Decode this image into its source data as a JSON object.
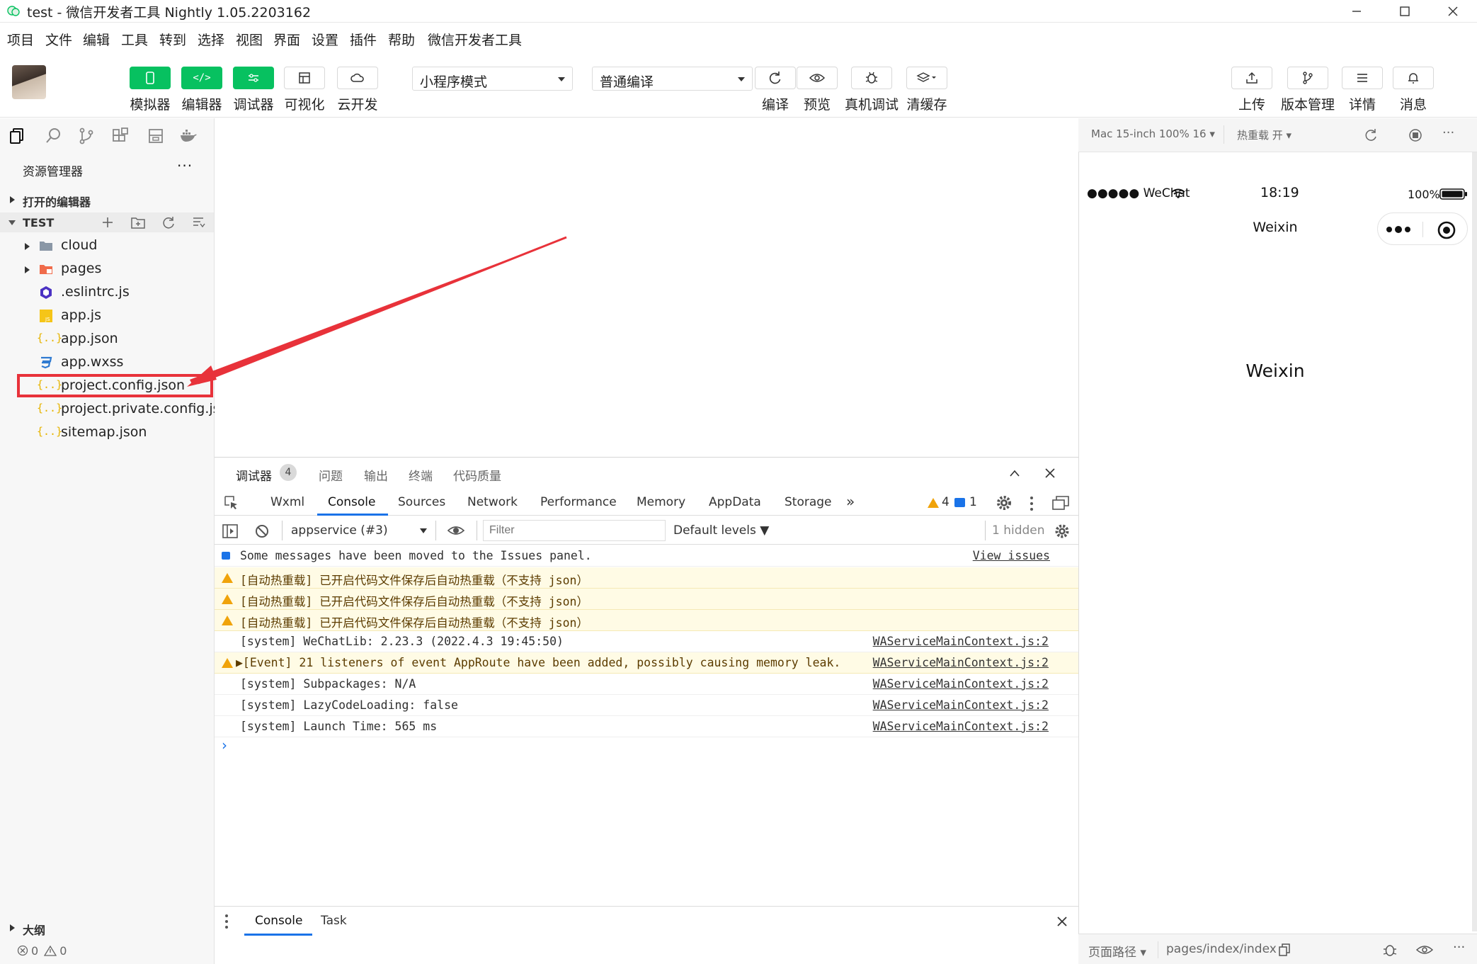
{
  "window": {
    "title": "test - 微信开发者工具 Nightly 1.05.2203162"
  },
  "menu": [
    "项目",
    "文件",
    "编辑",
    "工具",
    "转到",
    "选择",
    "视图",
    "界面",
    "设置",
    "插件",
    "帮助",
    "微信开发者工具"
  ],
  "toolbar": {
    "simulator": "模拟器",
    "editor": "编辑器",
    "debugger": "调试器",
    "visual": "可视化",
    "cloud": "云开发",
    "mode_select": "小程序模式",
    "compile_select": "普通编译",
    "compile": "编译",
    "preview": "预览",
    "real_debug": "真机调试",
    "clear_cache": "清缓存",
    "upload": "上传",
    "version": "版本管理",
    "details": "详情",
    "messages": "消息"
  },
  "explorer": {
    "title": "资源管理器",
    "more": "···",
    "open_editors": "打开的编辑器",
    "project": "TEST",
    "items": [
      {
        "name": "cloud",
        "icon": "folder-icon"
      },
      {
        "name": "pages",
        "icon": "folder-pages-icon"
      },
      {
        "name": ".eslintrc.js",
        "icon": "eslint-icon"
      },
      {
        "name": "app.js",
        "icon": "js-file-icon"
      },
      {
        "name": "app.json",
        "icon": "json-file-icon"
      },
      {
        "name": "app.wxss",
        "icon": "wxss-file-icon"
      },
      {
        "name": "project.config.json",
        "icon": "json-file-icon"
      },
      {
        "name": "project.private.config.js...",
        "icon": "json-file-icon"
      },
      {
        "name": "sitemap.json",
        "icon": "json-file-icon"
      }
    ],
    "outline": "大纲",
    "status_errors": "0",
    "status_warnings": "0"
  },
  "devtools": {
    "panel_tabs": [
      "调试器",
      "问题",
      "输出",
      "终端",
      "代码质量"
    ],
    "debugger_badge": "4",
    "tabs": [
      "Wxml",
      "Console",
      "Sources",
      "Network",
      "Performance",
      "Memory",
      "AppData",
      "Storage"
    ],
    "more_tabs": "»",
    "warn_count": "4",
    "info_count": "1",
    "context": "appservice (#3)",
    "filter_placeholder": "Filter",
    "levels": "Default levels ▼",
    "hidden": "1 hidden",
    "info_line": "Some messages have been moved to the Issues panel.",
    "view_issues": "View issues",
    "lines": [
      {
        "type": "warn",
        "text": "[自动热重载] 已开启代码文件保存后自动热重载（不支持 json）",
        "src": ""
      },
      {
        "type": "warn",
        "text": "[自动热重载] 已开启代码文件保存后自动热重载（不支持 json）",
        "src": ""
      },
      {
        "type": "warn",
        "text": "[自动热重载] 已开启代码文件保存后自动热重载（不支持 json）",
        "src": ""
      },
      {
        "type": "log",
        "text": "[system] WeChatLib: 2.23.3 (2022.4.3 19:45:50)",
        "src": "WAServiceMainContext.js:2"
      },
      {
        "type": "warn",
        "text": "▶[Event] 21 listeners of event AppRoute have been added, possibly causing memory leak.",
        "src": "WAServiceMainContext.js:2"
      },
      {
        "type": "log",
        "text": "[system] Subpackages: N/A",
        "src": "WAServiceMainContext.js:2"
      },
      {
        "type": "log",
        "text": "[system] LazyCodeLoading: false",
        "src": "WAServiceMainContext.js:2"
      },
      {
        "type": "log",
        "text": "[system] Launch Time: 565 ms",
        "src": "WAServiceMainContext.js:2"
      }
    ],
    "prompt": "›",
    "drawer_tabs": [
      "Console",
      "Task"
    ]
  },
  "simulator": {
    "device": "Mac 15-inch 100% 16 ▾",
    "hot_reload": "热重载 开 ▾",
    "more": "···",
    "carrier": "●●●●● WeChat",
    "time": "18:19",
    "battery": "100%",
    "nav_title": "Weixin",
    "page_text": "Weixin",
    "path_label": "页面路径 ▾",
    "path": "pages/index/index"
  },
  "colors": {
    "accent": "#07c160",
    "highlight": "#e8323a",
    "warn_bg": "#fffbe5"
  }
}
